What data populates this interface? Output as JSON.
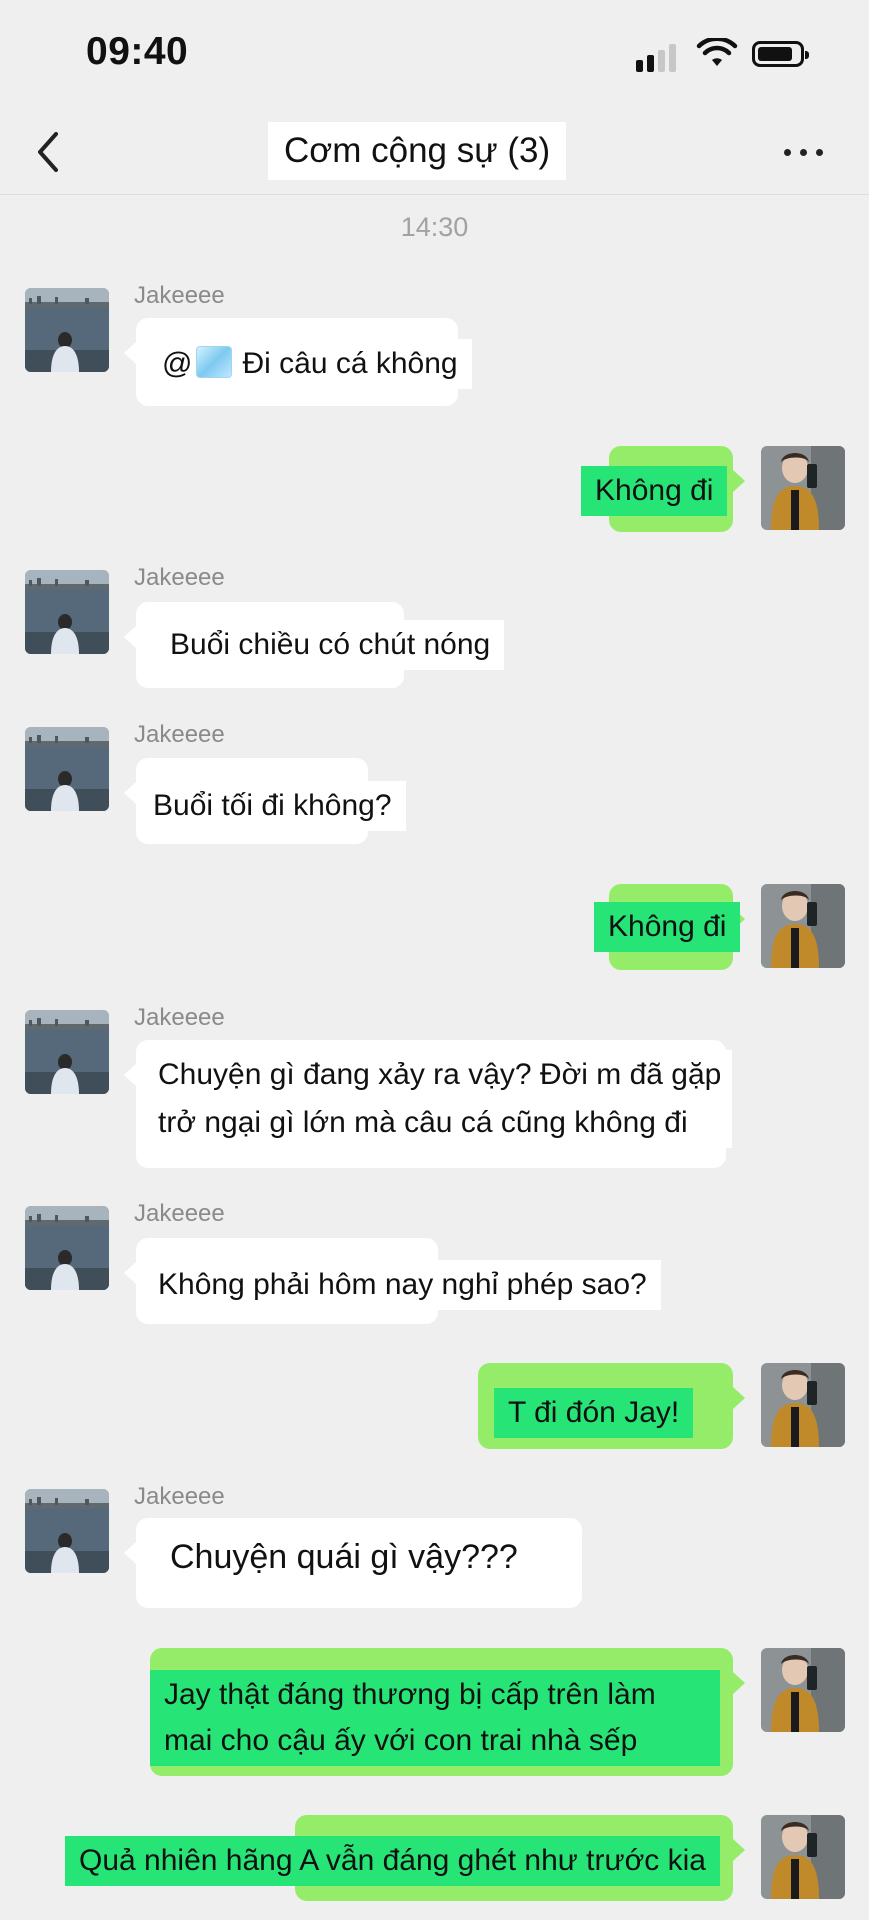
{
  "status_bar": {
    "time": "09:40"
  },
  "header": {
    "title": "Cơm cộng sự (3)"
  },
  "timestamp": "14:30",
  "messages": [
    {
      "sender": "Jakeeee",
      "mention": "@",
      "text": "Đi câu cá không"
    },
    {
      "sender": "me",
      "text": "Không đi"
    },
    {
      "sender": "Jakeeee",
      "text": "Buổi chiều có chút nóng"
    },
    {
      "sender": "Jakeeee",
      "text": "Buổi tối đi không?"
    },
    {
      "sender": "me",
      "text": "Không đi"
    },
    {
      "sender": "Jakeeee",
      "lines": [
        "Chuyện gì đang xảy ra vậy? Đời m đã gặp",
        "trở ngại gì lớn mà câu cá cũng không đi"
      ]
    },
    {
      "sender": "Jakeeee",
      "text": "Không phải hôm nay nghỉ phép sao?"
    },
    {
      "sender": "me",
      "text": "T đi đón Jay!"
    },
    {
      "sender": "Jakeeee",
      "text": "Chuyện quái gì vậy???"
    },
    {
      "sender": "me",
      "lines": [
        "Jay thật đáng thương bị cấp trên làm",
        "mai cho cậu ấy với con trai nhà sếp"
      ]
    },
    {
      "sender": "me",
      "text": "Quả nhiên hãng A vẫn đáng ghét như trước kia"
    }
  ],
  "icons": {
    "back": "chevron-left-icon",
    "more": "more-dots-icon",
    "mention_sticker": "ice-cube-icon"
  },
  "colors": {
    "background": "#efefef",
    "my_bubble": "#95ec69",
    "text_highlight_green": "#27e476",
    "other_bubble": "#ffffff",
    "muted_text": "#8a8a8a"
  }
}
